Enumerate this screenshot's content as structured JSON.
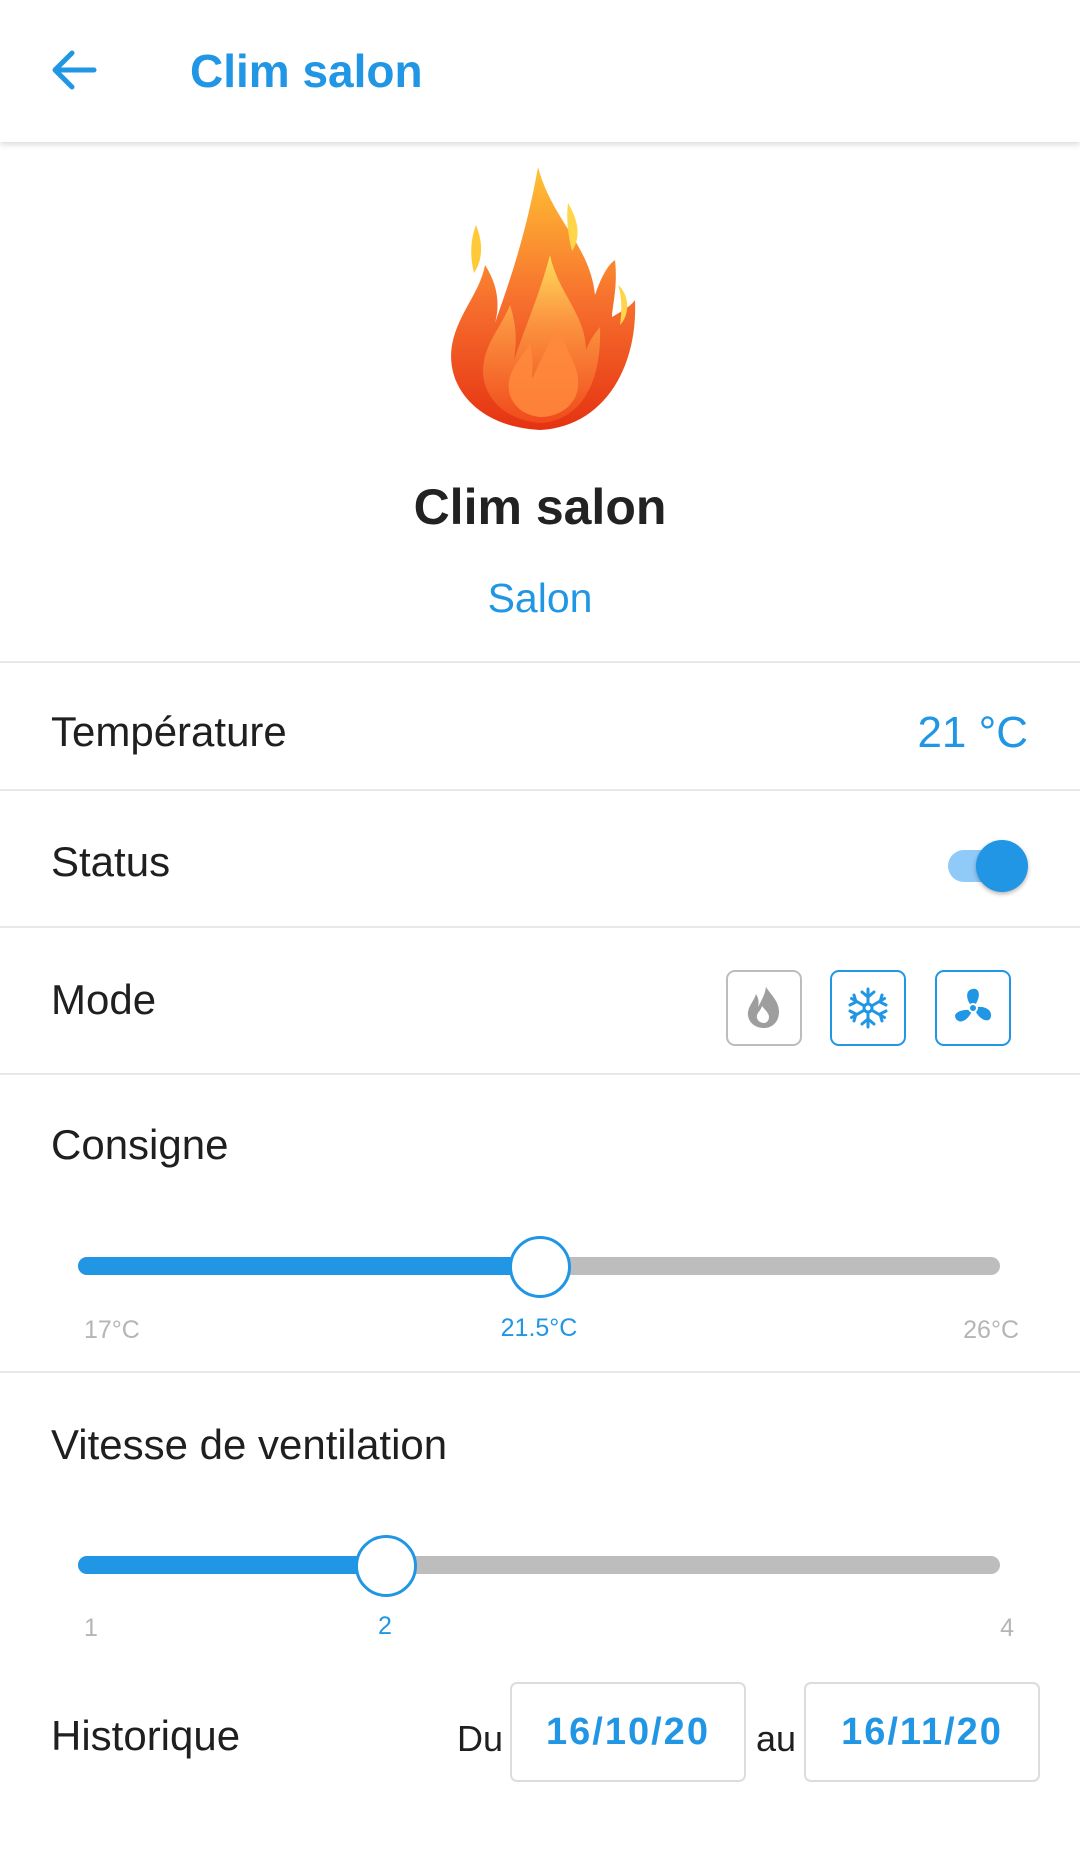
{
  "header": {
    "title": "Clim salon",
    "back_icon": "arrow-left-icon"
  },
  "device": {
    "icon": "flame-icon",
    "name": "Clim salon",
    "room": "Salon"
  },
  "temperature": {
    "label": "Température",
    "value": "21 °C"
  },
  "status": {
    "label": "Status",
    "on": true
  },
  "mode": {
    "label": "Mode",
    "options": [
      {
        "icon": "flame-icon",
        "active": false
      },
      {
        "icon": "snowflake-icon",
        "active": true
      },
      {
        "icon": "fan-icon",
        "active": true
      }
    ]
  },
  "setpoint": {
    "label": "Consigne",
    "min_label": "17°C",
    "current_label": "21.5°C",
    "max_label": "26°C",
    "min": 17,
    "max": 26,
    "value": 21.5
  },
  "fan_speed": {
    "label": "Vitesse de ventilation",
    "min_label": "1",
    "current_label": "2",
    "max_label": "4",
    "min": 1,
    "max": 4,
    "value": 2
  },
  "history": {
    "label": "Historique",
    "from_label": "Du",
    "from_date": "16/10/20",
    "to_label": "au",
    "to_date": "16/11/20"
  },
  "colors": {
    "accent": "#2196e4",
    "inactive": "#bdbdbd",
    "text": "#1f1f1f"
  }
}
